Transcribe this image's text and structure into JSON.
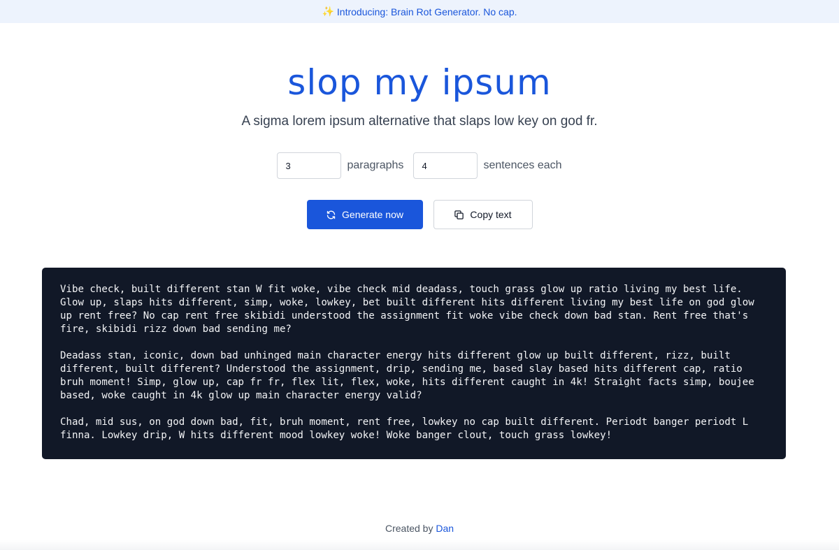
{
  "banner": {
    "icon": "sparkles-icon",
    "text": "Introducing: Brain Rot Generator. No cap."
  },
  "hero": {
    "title": "slop my ipsum",
    "subtitle": "A sigma lorem ipsum alternative that slaps low key on god fr."
  },
  "controls": {
    "paragraphs_value": "3",
    "paragraphs_label": "paragraphs",
    "sentences_value": "4",
    "sentences_label": "sentences each"
  },
  "buttons": {
    "generate_label": "Generate now",
    "generate_icon": "refresh-icon",
    "copy_label": "Copy text",
    "copy_icon": "copy-icon"
  },
  "output": {
    "paragraphs": [
      "Vibe check, built different stan W fit woke, vibe check mid deadass, touch grass glow up ratio living my best life. Glow up, slaps hits different, simp, woke, lowkey, bet built different hits different living my best life on god glow up rent free? No cap rent free skibidi understood the assignment fit woke vibe check down bad stan. Rent free that's fire, skibidi rizz down bad sending me?",
      "Deadass stan, iconic, down bad unhinged main character energy hits different glow up built different, rizz, built different, built different? Understood the assignment, drip, sending me, based slay based hits different cap, ratio bruh moment! Simp, glow up, cap fr fr, flex lit, flex, woke, hits different caught in 4k! Straight facts simp, boujee based, woke caught in 4k glow up main character energy valid?",
      "Chad, mid sus, on god down bad, fit, bruh moment, rent free, lowkey no cap built different. Periodt banger periodt L finna. Lowkey drip, W hits different mood lowkey woke! Woke banger clout, touch grass lowkey!"
    ]
  },
  "footer": {
    "prefix": "Created by",
    "author": "Dan"
  },
  "colors": {
    "accent": "#1a56db",
    "banner_bg": "#edf3fd",
    "output_bg": "#111827",
    "output_text": "#f3f4f6"
  }
}
